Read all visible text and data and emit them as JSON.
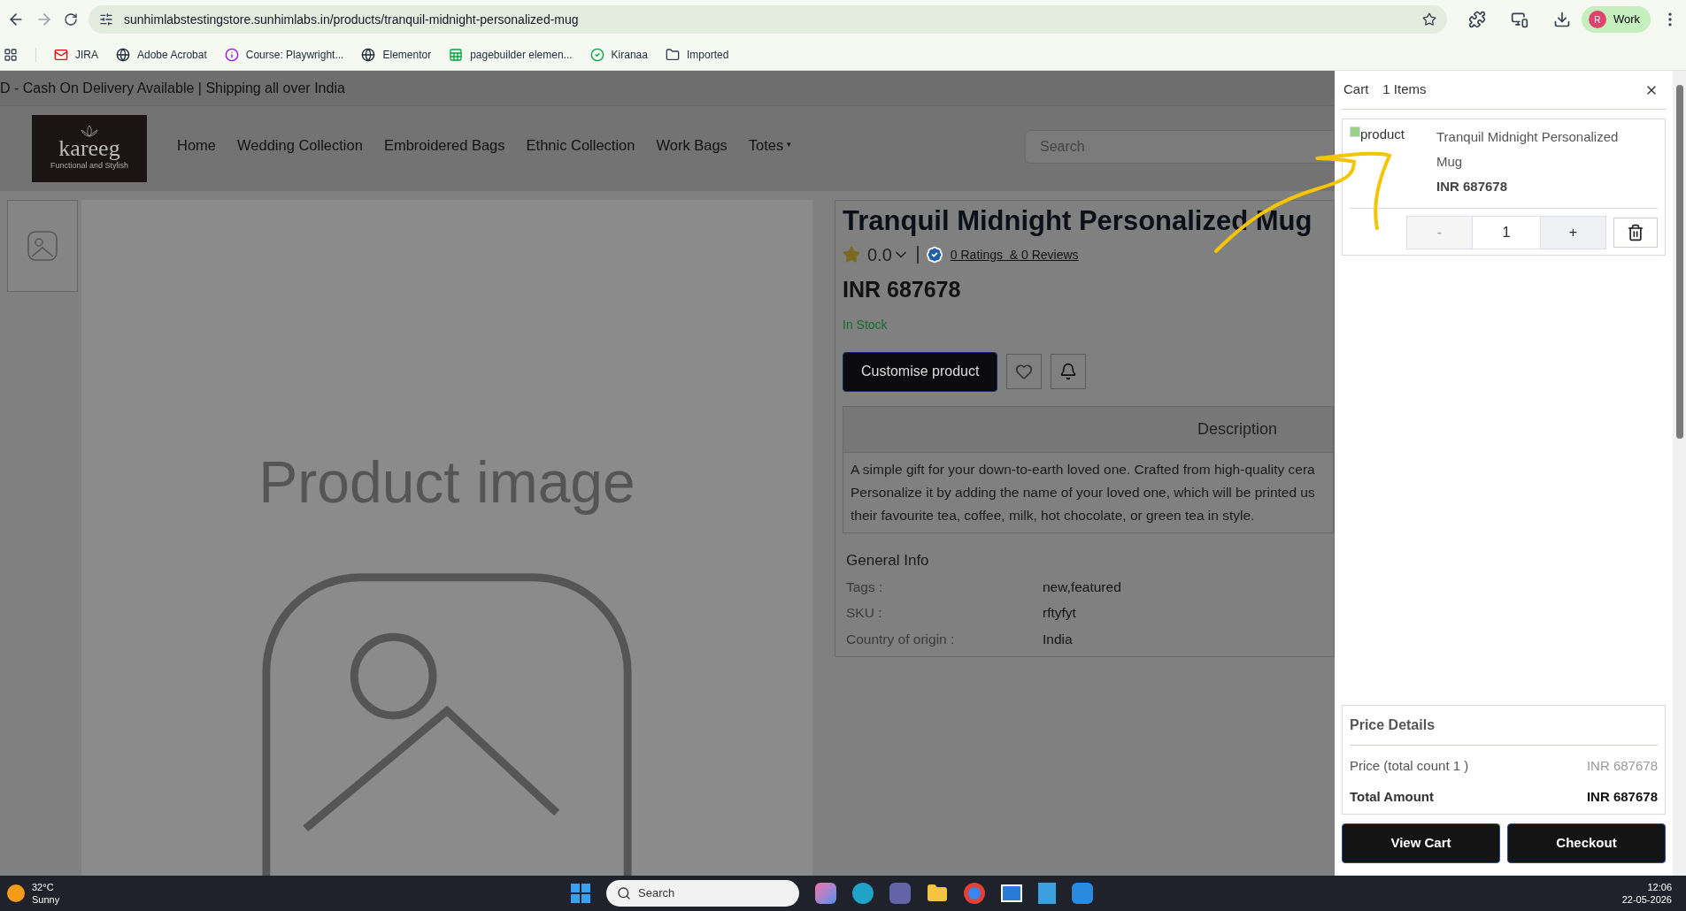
{
  "browser": {
    "url": "sunhimlabstestingstore.sunhimlabs.in/products/tranquil-midnight-personalized-mug",
    "profile": "Work",
    "profile_initial": "R",
    "bookmarks": [
      {
        "label": "JIRA",
        "kind": "mail"
      },
      {
        "label": "Adobe Acrobat",
        "kind": "globe"
      },
      {
        "label": "Course: Playwright...",
        "kind": "course"
      },
      {
        "label": "Elementor",
        "kind": "globe"
      },
      {
        "label": "pagebuilder elemen...",
        "kind": "sheet"
      },
      {
        "label": "Kiranaa",
        "kind": "check"
      },
      {
        "label": "Imported",
        "kind": "folder"
      }
    ]
  },
  "announcement": "D - Cash On Delivery Available | Shipping all over India",
  "header": {
    "logo": "kareeg",
    "logo_tagline": "Functional and Stylish",
    "nav": [
      {
        "label": "Home"
      },
      {
        "label": "Wedding Collection"
      },
      {
        "label": "Embroidered Bags"
      },
      {
        "label": "Ethnic Collection"
      },
      {
        "label": "Work Bags"
      },
      {
        "label": "Totes",
        "caret": "▾"
      }
    ],
    "search": {
      "placeholder": "Search"
    }
  },
  "gallery": {
    "placeholder_text": "Product image"
  },
  "product": {
    "title": "Tranquil Midnight Personalized Mug",
    "rating": "0.0",
    "ratings_link": "0 Ratings  & 0 Reviews",
    "price": "INR 687678",
    "stock": "In Stock",
    "customise_button": "Customise product",
    "tabs": [
      {
        "label": "Description",
        "selected": true
      }
    ],
    "description": [
      "A simple gift for your down-to-earth loved one. Crafted from high-quality cera",
      "Personalize it by adding the name of your loved one, which will be printed us",
      "their favourite tea, coffee, milk, hot chocolate, or green tea in style."
    ],
    "general_info": {
      "title": "General Info",
      "rows": [
        {
          "label": "Tags :",
          "value": "new,featured"
        },
        {
          "label": "SKU :",
          "value": "rftyfyt"
        },
        {
          "label": "Country of origin :",
          "value": "India"
        }
      ]
    }
  },
  "cart": {
    "title": "Cart",
    "count": "1 Items",
    "items": [
      {
        "image_alt": "product",
        "name_lines": [
          "Tranquil Midnight Personalized",
          "Mug"
        ],
        "price": "INR 687678",
        "decrement": "-",
        "quantity": "1",
        "increment": "+"
      }
    ],
    "price_details": {
      "title": "Price Details",
      "rows": [
        {
          "label": "Price (total count 1 )",
          "value": "INR 687678",
          "total": false
        },
        {
          "label": "Total Amount",
          "value": "INR 687678",
          "total": true
        }
      ]
    },
    "buttons": [
      "View Cart",
      "Checkout"
    ]
  },
  "taskbar": {
    "temperature": "32°C",
    "weather": "Sunny",
    "search_placeholder": "Search",
    "time": "12:06",
    "date": "22-05-2026"
  }
}
